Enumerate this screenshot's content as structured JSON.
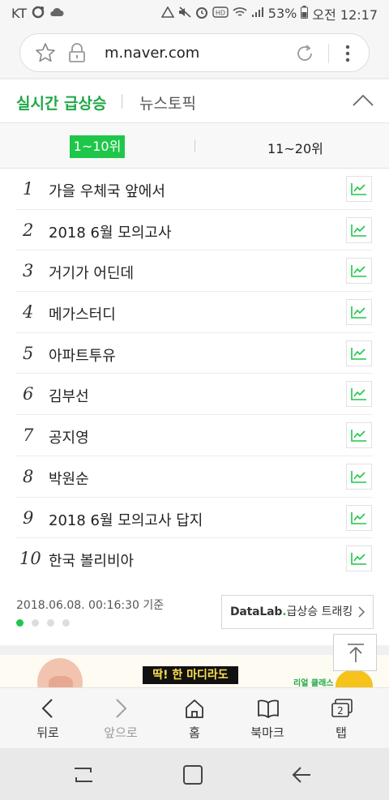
{
  "status_bar": {
    "carrier": "KT",
    "battery": "53%",
    "time": "오전 12:17"
  },
  "browser": {
    "url": "m.naver.com"
  },
  "section_tabs": {
    "active": "실시간 급상승",
    "inactive": "뉴스토픽"
  },
  "range_tabs": {
    "active": "1~10위",
    "inactive": "11~20위"
  },
  "ranks": [
    {
      "rank": "1",
      "keyword": "가을 우체국 앞에서"
    },
    {
      "rank": "2",
      "keyword": "2018 6월 모의고사"
    },
    {
      "rank": "3",
      "keyword": "거기가 어딘데"
    },
    {
      "rank": "4",
      "keyword": "메가스터디"
    },
    {
      "rank": "5",
      "keyword": "아파트투유"
    },
    {
      "rank": "6",
      "keyword": "김부선"
    },
    {
      "rank": "7",
      "keyword": "공지영"
    },
    {
      "rank": "8",
      "keyword": "박원순"
    },
    {
      "rank": "9",
      "keyword": "2018 6월 모의고사 답지"
    },
    {
      "rank": "10",
      "keyword": "한국 볼리비아"
    }
  ],
  "list_footer": {
    "timestamp": "2018.06.08. 00:16:30 기준",
    "datalab_brand": "DataLab",
    "datalab_dot": ".",
    "datalab_label": "급상승 트래킹",
    "pages": 4,
    "current_page": 1
  },
  "banner": {
    "headline": "딱! 한 마디라도",
    "tag": "리얼 클래스"
  },
  "bottom_nav": {
    "back": "뒤로",
    "forward": "앞으로",
    "home": "홈",
    "bookmark": "북마크",
    "tabs": "탭",
    "tab_count": "2"
  },
  "colors": {
    "accent": "#1ec74a",
    "accent_text": "#1ea845"
  }
}
